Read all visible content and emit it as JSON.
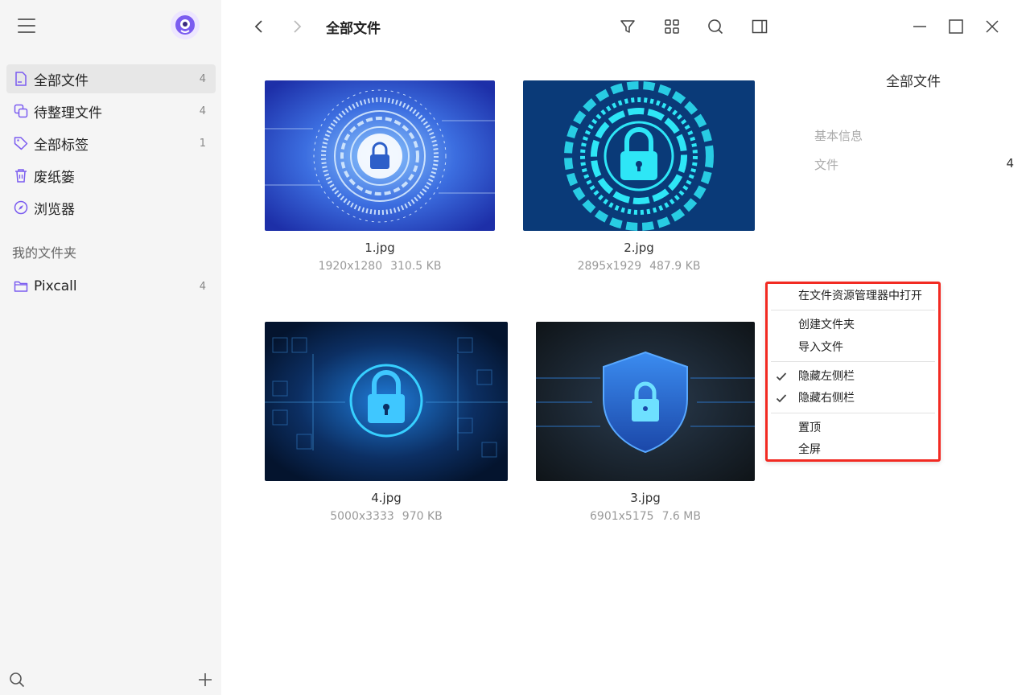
{
  "sidebar": {
    "nav": [
      {
        "label": "全部文件",
        "count": "4",
        "icon": "file-icon"
      },
      {
        "label": "待整理文件",
        "count": "4",
        "icon": "copy-icon"
      },
      {
        "label": "全部标签",
        "count": "1",
        "icon": "tag-icon"
      },
      {
        "label": "废纸篓",
        "count": "",
        "icon": "trash-icon"
      },
      {
        "label": "浏览器",
        "count": "",
        "icon": "compass-icon"
      }
    ],
    "section_title": "我的文件夹",
    "folders": [
      {
        "label": "Pixcall",
        "count": "4",
        "icon": "folder-icon"
      }
    ]
  },
  "toolbar": {
    "title": "全部文件"
  },
  "files": [
    {
      "name": "1.jpg",
      "dims": "1920x1280",
      "size": "310.5 KB"
    },
    {
      "name": "2.jpg",
      "dims": "2895x1929",
      "size": "487.9 KB"
    },
    {
      "name": "4.jpg",
      "dims": "5000x3333",
      "size": "970 KB"
    },
    {
      "name": "3.jpg",
      "dims": "6901x5175",
      "size": "7.6 MB"
    }
  ],
  "right_panel": {
    "title": "全部文件",
    "section": "基本信息",
    "file_label": "文件",
    "file_count": "4"
  },
  "context_menu": {
    "items": [
      {
        "label": "在文件资源管理器中打开",
        "checked": false
      },
      {
        "label": "创建文件夹",
        "checked": false
      },
      {
        "label": "导入文件",
        "checked": false
      },
      {
        "label": "隐藏左侧栏",
        "checked": true
      },
      {
        "label": "隐藏右侧栏",
        "checked": true
      },
      {
        "label": "置顶",
        "checked": false
      },
      {
        "label": "全屏",
        "checked": false
      }
    ]
  },
  "colors": {
    "accent": "#7b5cf0",
    "menu_highlight_border": "#f22a22"
  }
}
